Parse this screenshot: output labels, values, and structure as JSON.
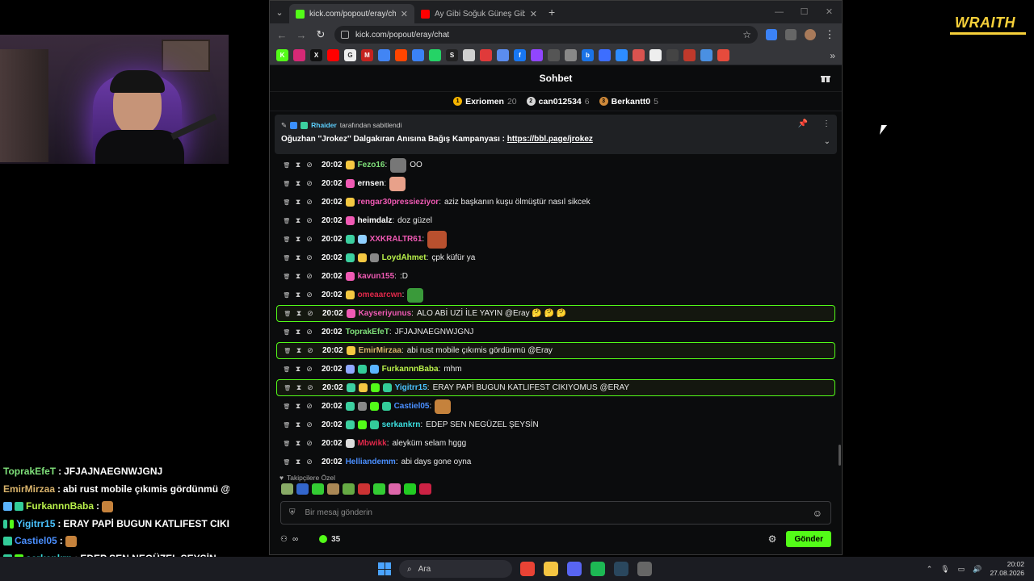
{
  "brand": {
    "text": "WRAITH"
  },
  "overlay_chat": [
    {
      "user": "ToprakEfeT",
      "user_color": "#7fe07a",
      "text": "JFJAJNAEGNWJGNJ",
      "badges": [],
      "emote": false
    },
    {
      "user": "EmirMirzaa",
      "user_color": "#d9b36b",
      "text": "abi rust mobile çıkımis gördünmü @E",
      "badges": [],
      "emote": false
    },
    {
      "user": "FurkannnBaba",
      "user_color": "#b8f04a",
      "text": "",
      "badges": [
        "#5ab4ff",
        "#3c9"
      ],
      "emote": true
    },
    {
      "user": "Yigitrr15",
      "user_color": "#4ac3ff",
      "text": "ERAY PAPİ BUGUN KATLIFEST CIKI",
      "badges": [
        "#3c9",
        "#53fc18"
      ],
      "emote": false
    },
    {
      "user": "Castiel05",
      "user_color": "#4a8fff",
      "text": "",
      "badges": [
        "#3c9"
      ],
      "emote": true
    },
    {
      "user": "serkankrn",
      "user_color": "#3ce0e0",
      "text": "EDEP SEN NEGÜZEL ŞEYSİN",
      "badges": [
        "#3c9",
        "#53fc18"
      ],
      "emote": false
    },
    {
      "user": "Mbwikk",
      "user_color": "#e0284a",
      "text": "aleyküm selam hggg",
      "badges": [],
      "emote": false
    }
  ],
  "browser": {
    "tabs": [
      {
        "title": "kick.com/popout/eray/chat",
        "favicon_color": "#53fc18",
        "active": true
      },
      {
        "title": "Ay Gibi Soğuk Güneş Gibi Sıcak",
        "favicon_color": "#ff0000",
        "active": false
      }
    ],
    "new_tab": "+",
    "url": "kick.com/popout/eray/chat",
    "bookmarks": [
      {
        "c": "#53fc18",
        "t": "K"
      },
      {
        "c": "#d62976",
        "t": ""
      },
      {
        "c": "#111",
        "t": "X"
      },
      {
        "c": "#ff0000",
        "t": ""
      },
      {
        "c": "#eee",
        "t": "G"
      },
      {
        "c": "#c5221f",
        "t": "M"
      },
      {
        "c": "#4285f4",
        "t": ""
      },
      {
        "c": "#ff4500",
        "t": ""
      },
      {
        "c": "#3b82f6",
        "t": ""
      },
      {
        "c": "#25d366",
        "t": ""
      },
      {
        "c": "#222",
        "t": "S"
      },
      {
        "c": "#d0d0d0",
        "t": ""
      },
      {
        "c": "#e03a3a",
        "t": ""
      },
      {
        "c": "#5b8def",
        "t": ""
      },
      {
        "c": "#1877f2",
        "t": "f"
      },
      {
        "c": "#9146ff",
        "t": ""
      },
      {
        "c": "#555",
        "t": ""
      },
      {
        "c": "#888",
        "t": ""
      },
      {
        "c": "#1a73e8",
        "t": "b"
      },
      {
        "c": "#3d6eff",
        "t": ""
      },
      {
        "c": "#2d8cff",
        "t": ""
      },
      {
        "c": "#d9534f",
        "t": ""
      },
      {
        "c": "#eee",
        "t": ""
      },
      {
        "c": "#444",
        "t": ""
      },
      {
        "c": "#c0392b",
        "t": ""
      },
      {
        "c": "#4a90e2",
        "t": ""
      },
      {
        "c": "#e64b3c",
        "t": ""
      }
    ]
  },
  "chat": {
    "header_title": "Sohbet",
    "leaderboard": [
      {
        "name": "Exriomen",
        "count": "20",
        "color": "#f5b400",
        "rank": "1"
      },
      {
        "name": "can012534",
        "count": "6",
        "color": "#d8d8d8",
        "rank": "2"
      },
      {
        "name": "Berkantt0",
        "count": "5",
        "color": "#d08a3a",
        "rank": "3"
      }
    ],
    "pinned": {
      "who": "Rhaider",
      "by_text": "tarafından sabitlendi",
      "message": "Oğuzhan ''Jrokez'' Dalgakıran Anısına Bağış Kampanyası : ",
      "link": "https://bbl.page/jrokez"
    },
    "messages": [
      {
        "time": "20:02",
        "badges": [
          "#f5c842"
        ],
        "user": "Fezo16",
        "user_color": "#7fe07a",
        "text": "OO",
        "emote": "#777",
        "emote_first": true,
        "highlight": false
      },
      {
        "time": "20:02",
        "badges": [
          "#f05ab4"
        ],
        "user": "ernsen",
        "user_color": "#ffffff",
        "text": "",
        "emote": "#e8a18a",
        "emote_first": true,
        "highlight": false
      },
      {
        "time": "20:02",
        "badges": [
          "#f5c842"
        ],
        "user": "rengar30pressieziyor",
        "user_color": "#f05ab4",
        "text": "aziz başkanın kuşu ölmüştür nasıl sikcek",
        "emote": "",
        "highlight": false
      },
      {
        "time": "20:02",
        "badges": [
          "#f05ab4"
        ],
        "user": "heimdalz",
        "user_color": "#ffffff",
        "text": "doz güzel",
        "emote": "",
        "highlight": false
      },
      {
        "time": "20:02",
        "badges": [
          "#3cd0a0",
          "#8fd0ff"
        ],
        "user": "XXKRALTR61",
        "user_color": "#f05ab4",
        "text": "",
        "emote": "#b8502e",
        "emote_first": true,
        "highlight": false
      },
      {
        "time": "20:02",
        "badges": [
          "#3cd0a0",
          "#f5c842",
          "#888"
        ],
        "user": "LoydAhmet",
        "user_color": "#b8f04a",
        "text": "çpk küfür ya",
        "emote": "",
        "highlight": false
      },
      {
        "time": "20:02",
        "badges": [
          "#f05ab4"
        ],
        "user": "kavun155",
        "user_color": "#f05ab4",
        "text": ":D",
        "emote": "",
        "highlight": false
      },
      {
        "time": "20:02",
        "badges": [
          "#f5c842"
        ],
        "user": "omeaarcwn",
        "user_color": "#e0284a",
        "text": "",
        "emote": "#3a9a3a",
        "emote_first": true,
        "highlight": false
      },
      {
        "time": "20:02",
        "badges": [
          "#f05ab4"
        ],
        "user": "Kayseriyunus",
        "user_color": "#f05ab4",
        "text": "ALO ABİ UZİ İLE YAYIN @Eray 🤔 🤔 🤔",
        "emote": "",
        "highlight": true
      },
      {
        "time": "20:02",
        "badges": [],
        "user": "ToprakEfeT",
        "user_color": "#7fe07a",
        "text": "JFJAJNAEGNWJGNJ",
        "emote": "",
        "highlight": false
      },
      {
        "time": "20:02",
        "badges": [
          "#f5c842"
        ],
        "user": "EmirMirzaa",
        "user_color": "#d9b36b",
        "text": "abi rust mobile çıkımis gördünmü @Eray",
        "emote": "",
        "highlight": true
      },
      {
        "time": "20:02",
        "badges": [
          "#8fa8ff",
          "#3c9",
          "#5ab4ff"
        ],
        "user": "FurkannnBaba",
        "user_color": "#b8f04a",
        "text": "mhm",
        "emote": "",
        "highlight": false
      },
      {
        "time": "20:02",
        "badges": [
          "#3cd0a0",
          "#f5c842",
          "#53fc18",
          "#3c9"
        ],
        "user": "Yigitrr15",
        "user_color": "#4ac3ff",
        "text": "ERAY PAPİ BUGUN KATLIFEST CIKIYOMUS @ERAY",
        "emote": "",
        "highlight": true
      },
      {
        "time": "20:02",
        "badges": [
          "#3cd0a0",
          "#888",
          "#53fc18",
          "#3c9"
        ],
        "user": "Castiel05",
        "user_color": "#4a8fff",
        "text": "",
        "emote": "#c5823c",
        "emote_first": true,
        "highlight": false
      },
      {
        "time": "20:02",
        "badges": [
          "#3cd0a0",
          "#53fc18",
          "#3c9"
        ],
        "user": "serkankrn",
        "user_color": "#3ce0e0",
        "text": "EDEP SEN NEGÜZEL ŞEYSİN",
        "emote": "",
        "highlight": false
      },
      {
        "time": "20:02",
        "badges": [
          "#dddddd"
        ],
        "user": "Mbwikk",
        "user_color": "#e0284a",
        "text": "aleyküm selam hggg",
        "emote": "",
        "highlight": false
      },
      {
        "time": "20:02",
        "badges": [],
        "user": "Helliandemm",
        "user_color": "#4a8fff",
        "text": "abi days gone oyna",
        "emote": "",
        "highlight": false
      }
    ],
    "followers_label": "Takipçilere Özel",
    "emote_bar": [
      "#8a6",
      "#36c",
      "#3c3",
      "#a85",
      "#6a4",
      "#c33",
      "#3c3",
      "#d6a",
      "#2c2",
      "#c24"
    ],
    "input_placeholder": "Bir mesaj gönderin",
    "footer_infinity": "∞",
    "points": "35",
    "send_label": "Gönder"
  },
  "taskbar": {
    "search_placeholder": "Ara",
    "apps": [
      "#ea4335",
      "#f5c542",
      "#5865f2",
      "#1db954",
      "#2a475e",
      "#666"
    ],
    "clock_time": "20:02",
    "clock_date": "27.08.2026"
  }
}
